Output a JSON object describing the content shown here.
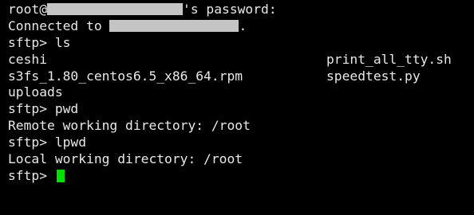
{
  "terminal": {
    "lines": {
      "password_prompt": {
        "user": "root@",
        "suffix": "'s password:"
      },
      "connected": {
        "prefix": "Connected to ",
        "suffix": "."
      },
      "cmd_ls": "sftp> ls",
      "ls_row1": {
        "left": "ceshi",
        "right": "print_all_tty.sh"
      },
      "ls_row2": {
        "left": "s3fs_1.80_centos6.5_x86_64.rpm",
        "right": "speedtest.py"
      },
      "ls_row3": {
        "left": "uploads"
      },
      "cmd_pwd": "sftp> pwd",
      "pwd_output": "Remote working directory: /root",
      "cmd_lpwd": "sftp> lpwd",
      "lpwd_output": "Local working directory: /root",
      "prompt": "sftp> "
    },
    "cursor_color": "#00e000",
    "text_color": "#e8e8e8",
    "background": "#000000"
  }
}
